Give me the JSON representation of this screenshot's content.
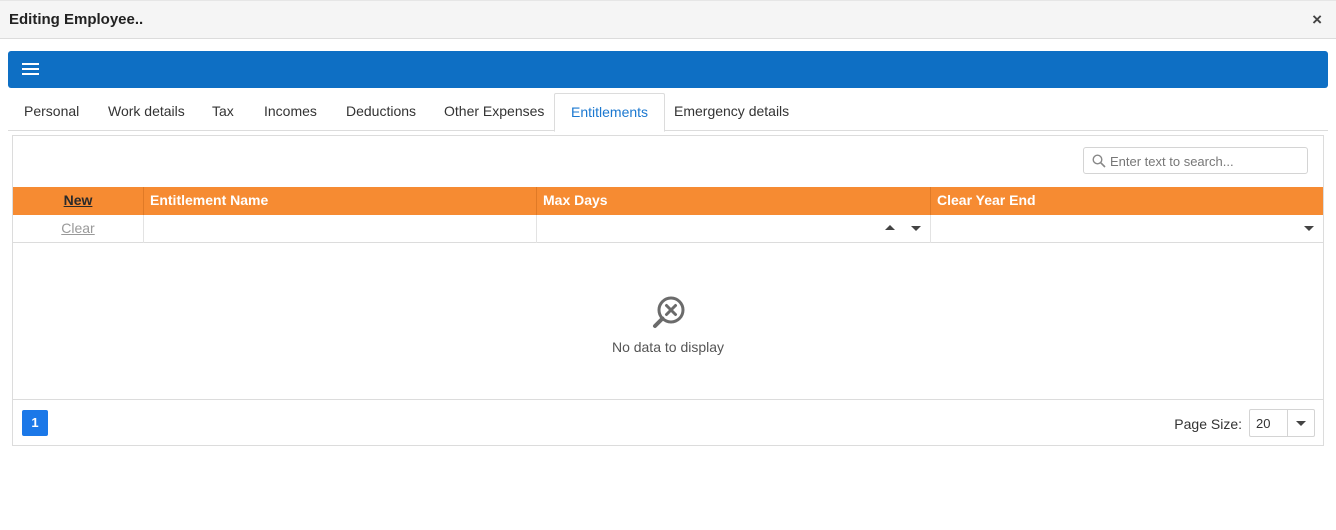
{
  "window": {
    "title": "Editing Employee..",
    "close_label": "×"
  },
  "toolbar": {
    "menu_icon": "hamburger-icon",
    "accent": "#0e6fc4"
  },
  "tabs": [
    {
      "label": "Personal",
      "active": false
    },
    {
      "label": "Work details",
      "active": false
    },
    {
      "label": "Tax",
      "active": false
    },
    {
      "label": "Incomes",
      "active": false
    },
    {
      "label": "Deductions",
      "active": false
    },
    {
      "label": "Other Expenses",
      "active": false
    },
    {
      "label": "Entitlements",
      "active": true
    },
    {
      "label": "Emergency details",
      "active": false
    }
  ],
  "search": {
    "placeholder": "Enter text to search...",
    "value": ""
  },
  "grid": {
    "header_color": "#f68b32",
    "new_label": "New",
    "columns": [
      "Entitlement Name",
      "Max Days",
      "Clear Year End"
    ],
    "clear_label": "Clear",
    "empty_message": "No data to display"
  },
  "pager": {
    "current_page": "1",
    "page_size_label": "Page Size:",
    "page_size_value": "20"
  }
}
